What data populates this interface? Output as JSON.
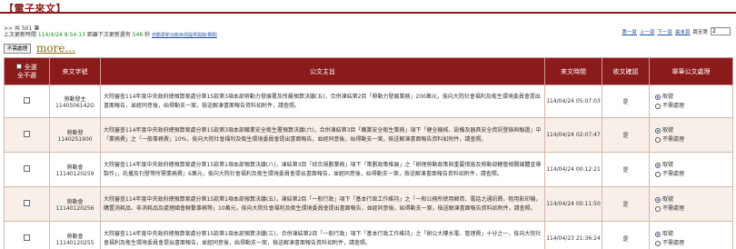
{
  "page": {
    "title": "【電子來文】",
    "total_text": ">> 共 501 筆",
    "update_prefix": "上次更新時間 ",
    "update_time": "114/4/24 8:54:13",
    "countdown_prefix": " 距離下次更新還有 ",
    "countdown_value": "546",
    "countdown_suffix": " 秒 ",
    "refresh_link": "自動更新功能目前提供開啟/關閉",
    "pager": {
      "first": "第一頁",
      "prev": "上一頁",
      "next": "下一頁",
      "last": "最末頁",
      "goto_label": "跳至第",
      "page_value": "2"
    },
    "no_process_button": "不需處理",
    "more_link": "more..."
  },
  "table": {
    "headers": {
      "select_all": "全選",
      "select_all_sub": "全不選",
      "doc_no": "來文字號",
      "subject": "公文主旨",
      "time": "來文時間",
      "receipt": "收文確認",
      "action": "單筆公文處理"
    },
    "option_take": "取號",
    "option_skip": "不需處理",
    "rows": [
      {
        "unit": "勞動發主",
        "number": "1140506142G",
        "subject": "大院審查114年度中央政府總預算案處分第15款第3項本部勞動力發展署及所屬預算決議(五)，合併凍結第2目「勞動力發展業務」200萬元，俟向大院社會福利及衛生環境委員會提出書面報告，並經同意後，始得動支一案，檢送解凍書面報告資料如附件，請查照。",
        "time": "114/04/24 05:07:03",
        "receipt": "是"
      },
      {
        "unit": "勞動發",
        "number": "1140251900",
        "subject": "大院審查114年度中央政府總預算案處分第15款第3項本部職業安全衛生署預算決議(六)，合併凍結第3目「職業安全衛生業務」項下「健全機械、設備及器具安全資訊登錄與驗證」中「業務費」之「一般事務費」10%，俟向大院社會福利及衛生環境委員會提出書面報告，並經同意後，始得動支一案，檢送解凍書面報告資料如附件，請查照。",
        "time": "114/04/24 02:07:47",
        "receipt": "是"
      },
      {
        "unit": "勞動會",
        "number": "11140120259",
        "subject": "大院審查114年度中央政府總預算案處分第15款第1項本部預算決議(八)，凍結第3目「綜合規劃業務」項下「策劃政策推展」之「辦理勞動政策與重要措施及勞動部轄管相關媒體宣導製作」，託播及刊登等所需業務費」6萬元，俟向大院社會福利及衛生環境委員會提出書面報告，並經同意後，始得動支一案，檢送解凍書面報告資料如附件，請查照。",
        "time": "114/04/24 00:12:21",
        "receipt": "是"
      },
      {
        "unit": "勞動會",
        "number": "11140120256",
        "subject": "大院審查114年度中央政府總預算案處分第15款第1項本部預算決議(五)，凍結第2目「一般行政」項下「基本行政工作維持」之「一般公務所使用郵資、電話之通訊費，租用影印機，購置消耗品、非消耗品及處理國會聯繫事務等」10萬元，俟向大院社會福利及衛生環境委員會提出書面報告，並經同意後，始得動支一案，檢送解凍書面報告資料如附件，請查照。",
        "time": "114/04/24 00:11:50",
        "receipt": "是"
      },
      {
        "unit": "勞動會",
        "number": "11140120255",
        "subject": "大院審查114年度中央政府總預算案處分第15款第1項本部預算決議(三)，合併凍結第2目「一般行政」項下「基本行政工作維持」之「辦公大樓水電、管理費」十分之一，俟向大院社會福利及衛生環境委員會提出書面報告，並經同意後，始得動支一案，檢送解凍書面報告資料如附件，請查照。",
        "time": "114/04/23 21:36:24",
        "receipt": "是"
      }
    ]
  },
  "colors": {
    "header_bg": "#8b1a1a",
    "title_color": "#8b1a1a",
    "more_color": "#8b6914",
    "countdown_color": "#1a8f1a"
  }
}
